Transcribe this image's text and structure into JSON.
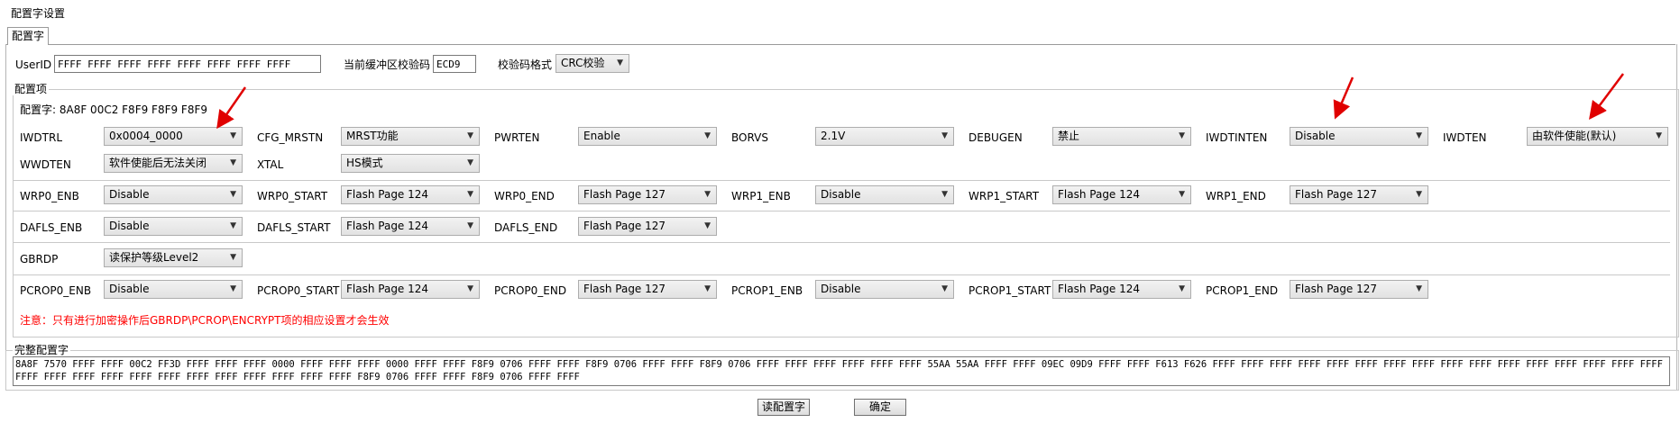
{
  "window_title": "配置字设置",
  "tab_label": "配置字",
  "top_row": {
    "userid_label": "UserID",
    "userid_value": "FFFF FFFF FFFF FFFF FFFF FFFF FFFF FFFF",
    "checksum_label": "当前缓冲区校验码",
    "checksum_value": "ECD9",
    "format_label": "校验码格式",
    "format_value": "CRC校验"
  },
  "config_group": {
    "legend": "配置项",
    "config_word_text": "配置字:  8A8F 00C2 F8F9 F8F9 F8F9",
    "row1": [
      {
        "label": "IWDTRL",
        "value": "0x0004_0000"
      },
      {
        "label": "CFG_MRSTN",
        "value": "MRST功能"
      },
      {
        "label": "PWRTEN",
        "value": "Enable"
      },
      {
        "label": "BORVS",
        "value": "2.1V"
      },
      {
        "label": "DEBUGEN",
        "value": "禁止"
      },
      {
        "label": "IWDTINTEN",
        "value": "Disable"
      },
      {
        "label": "IWDTEN",
        "value": "由软件使能(默认)"
      }
    ],
    "row2": [
      {
        "label": "WWDTEN",
        "value": "软件使能后无法关闭"
      },
      {
        "label": "XTAL",
        "value": "HS模式"
      }
    ],
    "row3": [
      {
        "label": "WRP0_ENB",
        "value": "Disable"
      },
      {
        "label": "WRP0_START",
        "value": "Flash Page 124"
      },
      {
        "label": "WRP0_END",
        "value": "Flash Page 127"
      },
      {
        "label": "WRP1_ENB",
        "value": "Disable"
      },
      {
        "label": "WRP1_START",
        "value": "Flash Page 124"
      },
      {
        "label": "WRP1_END",
        "value": "Flash Page 127"
      }
    ],
    "row4": [
      {
        "label": "DAFLS_ENB",
        "value": "Disable"
      },
      {
        "label": "DAFLS_START",
        "value": "Flash Page 124"
      },
      {
        "label": "DAFLS_END",
        "value": "Flash Page 127"
      }
    ],
    "row5": [
      {
        "label": "GBRDP",
        "value": "读保护等级Level2"
      }
    ],
    "row6": [
      {
        "label": "PCROP0_ENB",
        "value": "Disable"
      },
      {
        "label": "PCROP0_START",
        "value": "Flash Page 124"
      },
      {
        "label": "PCROP0_END",
        "value": "Flash Page 127"
      },
      {
        "label": "PCROP1_ENB",
        "value": "Disable"
      },
      {
        "label": "PCROP1_START",
        "value": "Flash Page 124"
      },
      {
        "label": "PCROP1_END",
        "value": "Flash Page 127"
      }
    ],
    "warning": "注意：只有进行加密操作后GBRDP\\PCROP\\ENCRYPT项的相应设置才会生效"
  },
  "full_group": {
    "legend": "完整配置字",
    "value": "8A8F 7570 FFFF FFFF 00C2 FF3D FFFF FFFF FFFF 0000 FFFF FFFF FFFF 0000 FFFF FFFF F8F9 0706 FFFF FFFF F8F9 0706 FFFF FFFF F8F9 0706 FFFF FFFF FFFF FFFF FFFF FFFF 55AA 55AA FFFF FFFF 09EC 09D9 FFFF FFFF F613 F626 FFFF FFFF FFFF FFFF FFFF FFFF FFFF FFFF FFFF FFFF FFFF FFFF FFFF FFFF FFFF FFFF FFFF FFFF FFFF FFFF FFFF FFFF FFFF FFFF FFFF FFFF FFFF FFFF F8F9 0706 FFFF FFFF F8F9 0706 FFFF FFFF"
  },
  "buttons": {
    "read_label": "读配置字",
    "ok_label": "确定"
  },
  "colors": {
    "warning": "#ff0000",
    "annotation_arrow": "#e00000"
  },
  "icons": {
    "dropdown": "chevron-down-icon",
    "annotation": "red-arrow-icon"
  }
}
